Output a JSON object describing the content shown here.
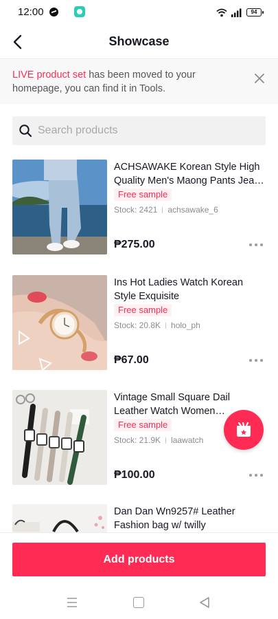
{
  "status_bar": {
    "time": "12:00",
    "battery": "94"
  },
  "header": {
    "title": "Showcase"
  },
  "notice": {
    "highlight": "LIVE product set",
    "text": " has been moved to your homepage, you can find it in Tools."
  },
  "search": {
    "placeholder": "Search products",
    "value": ""
  },
  "products": [
    {
      "title": "ACHSAWAKE  Korean Style High Quality Men's Maong Pants Jeans Korean",
      "badge": "Free sample",
      "stock": "Stock: 2421",
      "seller": "achsawake_6",
      "price": "₱275.00"
    },
    {
      "title": "Ins Hot Ladies Watch Korean Style Exquisite",
      "badge": "Free sample",
      "stock": "Stock: 20.8K",
      "seller": "holo_ph",
      "price": "₱67.00"
    },
    {
      "title": "Vintage Small Square Dail Leather Watch Women Wristwatch",
      "badge": "Free sample",
      "stock": "Stock: 21.9K",
      "seller": "laawatch",
      "price": "₱100.00"
    },
    {
      "title": "Dan Dan Wn9257# Leather Fashion bag w/ twilly",
      "badge": "",
      "stock": "",
      "seller": "",
      "price": ""
    }
  ],
  "footer": {
    "add_label": "Add products"
  },
  "colors": {
    "accent": "#fe2c55",
    "badge_bg": "#fff0f2",
    "notice_bg": "#f8f8f8"
  }
}
